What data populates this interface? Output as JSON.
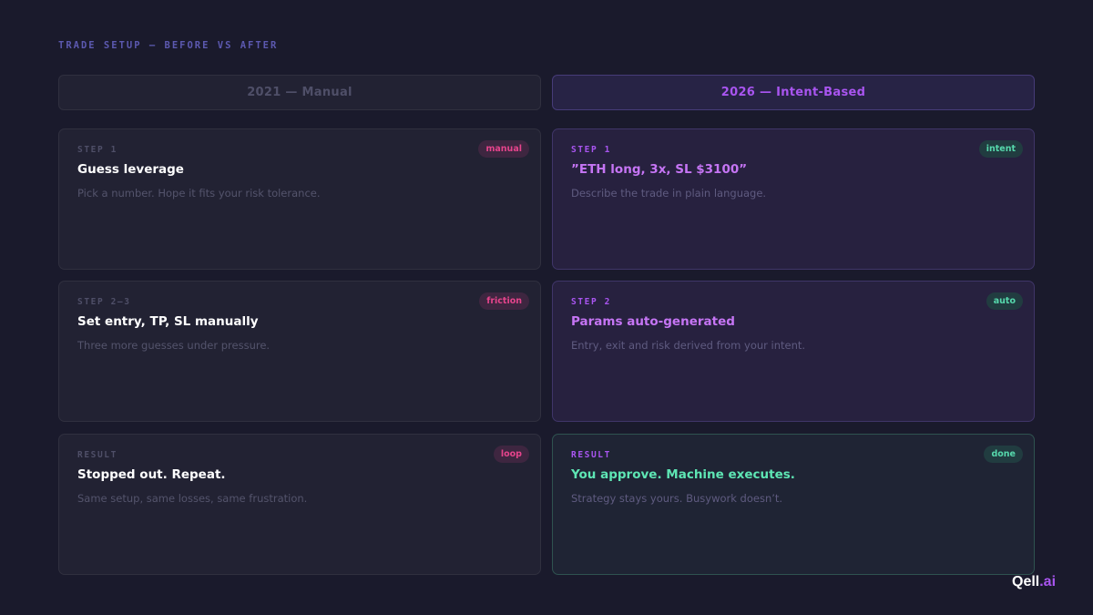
{
  "page_title": "TRADE SETUP — BEFORE VS AFTER",
  "columns": {
    "left": "2021 — Manual",
    "right": "2026 — Intent-Based"
  },
  "manual_cards": [
    {
      "step": "STEP 1",
      "badge": "manual",
      "title": "Guess leverage",
      "desc": "Pick a number. Hope it fits your risk tolerance."
    },
    {
      "step": "STEP 2–3",
      "badge": "friction",
      "title": "Set entry, TP, SL manually",
      "desc": "Three more guesses under pressure."
    },
    {
      "step": "RESULT",
      "badge": "loop",
      "title": "Stopped out. Repeat.",
      "desc": "Same setup, same losses, same frustration."
    }
  ],
  "intent_cards": [
    {
      "step": "STEP 1",
      "badge": "intent",
      "title": "”ETH long, 3x, SL $3100”",
      "desc": "Describe the trade in plain language."
    },
    {
      "step": "STEP 2",
      "badge": "auto",
      "title": "Params auto-generated",
      "desc": "Entry, exit and risk derived from your intent."
    },
    {
      "step": "RESULT",
      "badge": "done",
      "title": "You approve. Machine executes.",
      "desc": "Strategy stays yours. Busywork doesn’t."
    }
  ],
  "logo": {
    "main": "Qell",
    "suffix": ".ai"
  },
  "colors": {
    "background": "#1a1a2c",
    "accent_purple": "#a955f0",
    "badge_pink": "#e6448c",
    "badge_teal": "#56d8ac",
    "result_green": "#5ee6b4"
  }
}
